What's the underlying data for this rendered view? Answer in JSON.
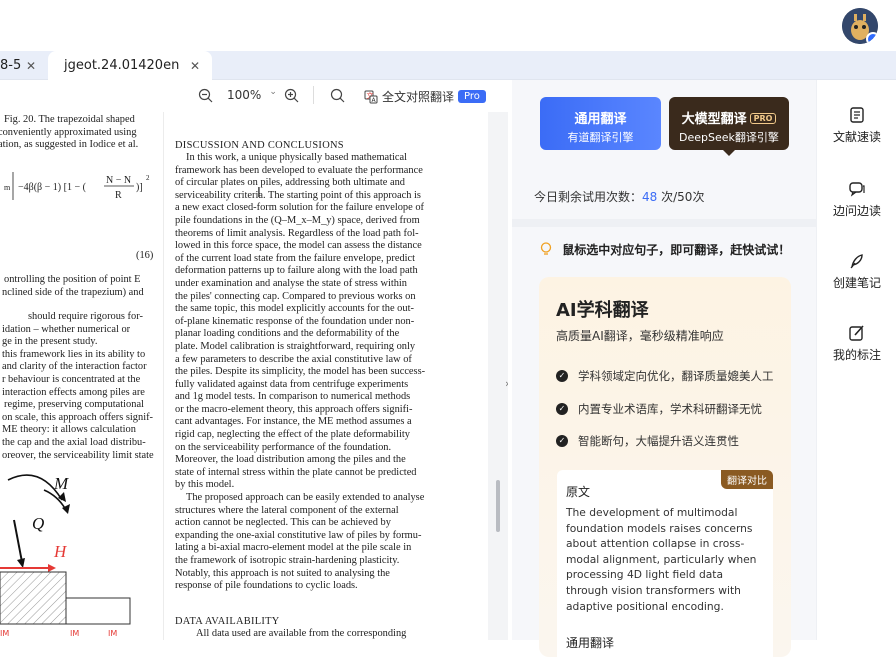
{
  "tabs": [
    {
      "label": "8-5",
      "close": "✕"
    },
    {
      "label": "jgeot.24.01420en",
      "close": "✕"
    }
  ],
  "toolbar": {
    "zoom_out_icon": "zoom-out-icon",
    "zoom": "100%",
    "zoom_in_icon": "zoom-in-icon",
    "search_icon": "search-icon",
    "translate_label": "全文对照翻译",
    "pro_badge": "Pro"
  },
  "doc_left_lines": [
    "Fig. 20. The trapezoidal shaped",
    "conveniently approximated using",
    "ation, as suggested in Iodice et al.",
    "(16)",
    "ontrolling the position of point E",
    "nclined side of the trapezium) and",
    "should require rigorous for-",
    "idation – whether numerical or",
    "ge in the present study.",
    "this framework lies in its ability to",
    "and clarity of the interaction factor",
    "r behaviour is concentrated at the",
    "interaction effects among piles are",
    "regime, preserving computational",
    "on scale, this approach offers signif-",
    "ME theory: it allows calculation",
    "the cap and the axial load distribu-",
    "oreover, the serviceability limit state"
  ],
  "diagram_labels": {
    "M": "M",
    "Q": "Q",
    "H": "H"
  },
  "doc_right": {
    "heading": "DISCUSSION AND CONCLUSIONS",
    "lines": [
      "In this work, a unique physically based mathematical",
      "framework has been developed to evaluate the performance",
      "of circular plates on piles, addressing both ultimate and",
      "serviceability criteria. The starting point of this approach is",
      "a new exact closed-form solution for the failure envelope of",
      "pile foundations in the (Q–M_x–M_y) space, derived from",
      "theorems of limit analysis. Regardless of the load path fol-",
      "lowed in this force space, the model can assess the distance",
      "of the current load state from the failure envelope, predict",
      "deformation patterns up to failure along with the load path",
      "under examination and analyse the state of stress within",
      "the piles' connecting cap. Compared to previous works on",
      "the same topic, this model explicitly accounts for the out-",
      "of-plane kinematic response of the foundation under non-",
      "planar loading conditions and the deformability of the",
      "plate. Model calibration is straightforward, requiring only",
      "a few parameters to describe the axial constitutive law of",
      "the piles. Despite its simplicity, the model has been success-",
      "fully validated against data from centrifuge experiments",
      "and 1g model tests. In comparison to numerical methods",
      "or the macro-element theory, this approach offers signifi-",
      "cant advantages. For instance, the ME method assumes a",
      "rigid cap, neglecting the effect of the plate deformability",
      "on the serviceability performance of the foundation.",
      "Moreover, the load distribution among the piles and the",
      "state of internal stress within the plate cannot be predicted",
      "by this model.",
      "The proposed approach can be easily extended to analyse",
      "structures where the lateral component of the external",
      "action cannot be neglected. This can be achieved by",
      "expanding the one-axial constitutive law of piles by formu-",
      "lating a bi-axial macro-element model at the pile scale in",
      "the framework of isotropic strain-hardening plasticity.",
      "Notably, this approach is not suited to analysing the",
      "response of pile foundations to cyclic loads."
    ],
    "heading2": "DATA AVAILABILITY",
    "last_line": "All data used are available from the corresponding"
  },
  "panel": {
    "btn1_title": "通用翻译",
    "btn1_sub": "有道翻译引擎",
    "btn2_title": "大模型翻译",
    "btn2_pro": "PRO",
    "btn2_sub": "DeepSeek翻译引擎",
    "quota_label": "今日剩余试用次数：",
    "quota_used": "48",
    "quota_rest": "次/50次",
    "tip": "鼠标选中对应句子，即可翻译，赶快试试！",
    "card_title": "AI学科翻译",
    "card_sub": "高质量AI翻译，毫秒级精准响应",
    "features": [
      "学科领域定向优化，翻译质量媲美人工",
      "内置专业术语库，学术科研翻译无忧",
      "智能断句，大幅提升语义连贯性"
    ],
    "compare_tag": "翻译对比",
    "original_label": "原文",
    "original_text": "The development of multimodal foundation models raises concerns about attention collapse in cross-modal alignment, particularly when processing 4D light field data through vision transformers with adaptive positional encoding.",
    "general_label": "通用翻译"
  },
  "sidebar": [
    {
      "label": "文献速读",
      "icon": "document-read-icon"
    },
    {
      "label": "边问边读",
      "icon": "chat-icon"
    },
    {
      "label": "创建笔记",
      "icon": "pen-icon"
    },
    {
      "label": "我的标注",
      "icon": "edit-icon"
    }
  ],
  "colors": {
    "accent": "#3b6cf6",
    "dark_btn": "#3a2a1c",
    "diagram_red": "#e53935"
  }
}
